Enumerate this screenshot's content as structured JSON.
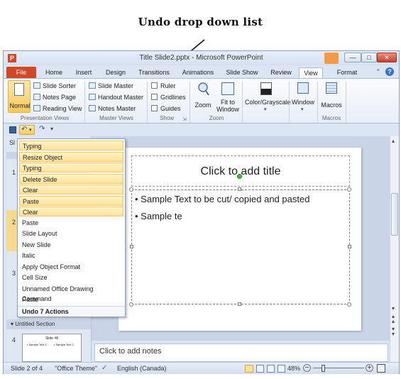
{
  "caption": "Undo drop down list",
  "window": {
    "app_icon": "P",
    "title": "Title Slide2.pptx  -  Microsoft PowerPoint"
  },
  "tabs": [
    "File",
    "Home",
    "Insert",
    "Design",
    "Transitions",
    "Animations",
    "Slide Show",
    "Review",
    "View",
    "Format"
  ],
  "ribbon": {
    "presentation_views": {
      "normal": "Normal",
      "slide_sorter": "Slide Sorter",
      "notes_page": "Notes Page",
      "reading_view": "Reading View",
      "label": "Presentation Views"
    },
    "master_views": {
      "slide_master": "Slide Master",
      "handout_master": "Handout Master",
      "notes_master": "Notes Master",
      "label": "Master Views"
    },
    "show": {
      "ruler": "Ruler",
      "gridlines": "Gridlines",
      "guides": "Guides",
      "label": "Show"
    },
    "zoom": {
      "zoom": "Zoom",
      "fit_to_window_1": "Fit to",
      "fit_to_window_2": "Window",
      "label": "Zoom"
    },
    "color": {
      "label": "Color/Grayscale"
    },
    "window_btn": {
      "label": "Window"
    },
    "macros": {
      "macros": "Macros",
      "label": "Macros"
    }
  },
  "undo_list": {
    "items": [
      "Typing",
      "Resize Object",
      "Typing",
      "Delete Slide",
      "Clear",
      "Paste",
      "Clear",
      "Paste",
      "Slide Layout",
      "New Slide",
      "Italic",
      "Apply Object Format",
      "Cell Size",
      "Unnamed Office Drawing Command",
      "Paste"
    ],
    "selected_count": 7,
    "footer": "Undo 7 Actions"
  },
  "slide": {
    "title": "Click to add title",
    "bullets": [
      "Sample Text to be cut/ copied and pasted",
      "Sample te"
    ]
  },
  "left_panel": {
    "tab_fragment": "Sl",
    "slide_numbers": [
      "1",
      "2",
      "3",
      "4"
    ],
    "section": "Untitled Section",
    "thumb_title": "Slide #8",
    "thumb_line1": "• Sample Text 1",
    "thumb_line2": "• Sample Text 2"
  },
  "notes": "Click to add notes",
  "status": {
    "slide": "Slide 2 of 4",
    "theme": "\"Office Theme\"",
    "language": "English (Canada)",
    "zoom": "48%"
  }
}
